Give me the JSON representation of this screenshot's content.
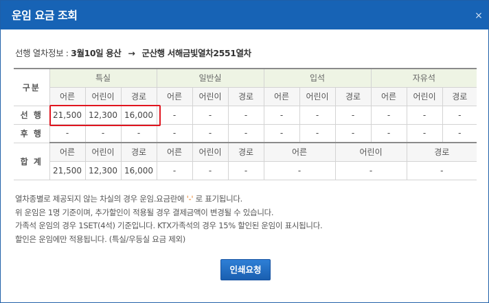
{
  "dialog": {
    "title": "운임 요금 조회",
    "close_label": "×"
  },
  "train_info": {
    "label": "선행 열차정보 : ",
    "route": "3월10일 용산",
    "arrow": "→",
    "destination": "군산행 서해금빛열차2551열차"
  },
  "table": {
    "division_label": "구분",
    "grades": [
      "특실",
      "일반실",
      "입석",
      "자유석"
    ],
    "passenger_types": [
      "어른",
      "어린이",
      "경로"
    ],
    "rows": [
      {
        "label": "선 행",
        "values": [
          "21,500",
          "12,300",
          "16,000",
          "-",
          "-",
          "-",
          "-",
          "-",
          "-",
          "-",
          "-",
          "-"
        ]
      },
      {
        "label": "후 행",
        "values": [
          "-",
          "-",
          "-",
          "-",
          "-",
          "-",
          "-",
          "-",
          "-",
          "-",
          "-",
          "-"
        ]
      }
    ],
    "total": {
      "label": "합 계",
      "headers": [
        "어른",
        "어린이",
        "경로",
        "어른",
        "어린이",
        "경로",
        "어른",
        "어린이",
        "경로"
      ],
      "values": [
        "21,500",
        "12,300",
        "16,000",
        "-",
        "-",
        "-",
        "-",
        "-",
        "-"
      ]
    }
  },
  "notes": {
    "line1_a": "열차종별로 제공되지 않는 차실의 경우 운임.요금란에 ",
    "line1_dash": "'-'",
    "line1_b": " 로 표기됩니다.",
    "line2": "위 운임은 1명 기준이며, 추가할인이 적용될 경우 결제금액이 변경될 수 있습니다.",
    "line3": "가족석 운임의 경우 1SET(4석) 기준입니다. KTX가족석의 경우 15% 할인된 운임이 표시됩니다.",
    "line4": "할인은 운임에만 적용됩니다. (특실/우등실 요금 제외)"
  },
  "print_button_label": "인쇄요청",
  "colors": {
    "titlebar": "#1763b5",
    "highlight": "#e0141e",
    "grade_header": "#eef4e4",
    "button": "#1a5fb0"
  }
}
